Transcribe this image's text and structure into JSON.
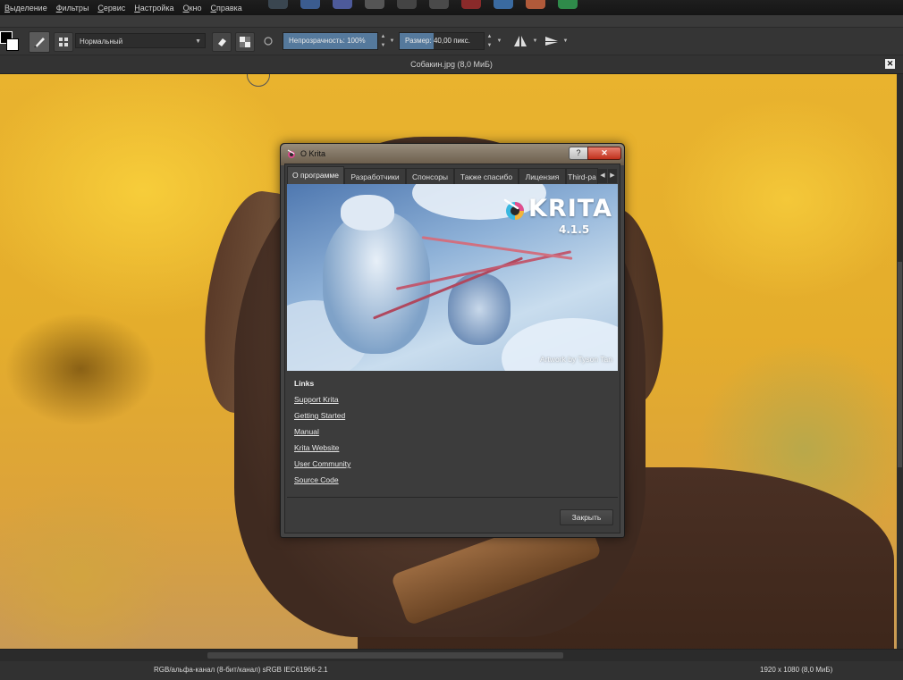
{
  "menubar": {
    "items": [
      "Выделение",
      "Фильтры",
      "Сервис",
      "Настройка",
      "Окно",
      "Справка"
    ]
  },
  "toolbar": {
    "blend_mode": "Нормальный",
    "opacity_label": "Непрозрачность:",
    "opacity_value": "100%",
    "opacity_fraction": 1.0,
    "size_label": "Размер:",
    "size_value": "40,00 пикс."
  },
  "document": {
    "title": "Собакин.jpg (8,0 МиБ)"
  },
  "status": {
    "color_profile": "RGB/альфа-канал (8-бит/канал)  sRGB IEC61966-2.1",
    "dimensions": "1920 x 1080 (8,0 МиБ)"
  },
  "dialog": {
    "title": "О Krita",
    "help_label": "?",
    "close_label": "✕",
    "tabs": [
      "О программе",
      "Разработчики",
      "Спонсоры",
      "Также спасибо",
      "Лицензия",
      "Third-pa"
    ],
    "active_tab": 0,
    "banner": {
      "logo_text": "KRITA",
      "version": "4.1.5",
      "credit": "Artwork by Tyson Tan"
    },
    "links_heading": "Links",
    "links": [
      "Support Krita",
      "Getting Started",
      "Manual",
      "Krita Website",
      "User Community",
      "Source Code"
    ],
    "close_button": "Закрыть"
  },
  "colors": {
    "accent": "#55799c",
    "dialog_bg": "#3c3c3c",
    "close_red": "#c0301c"
  },
  "icons": [
    "krita-app-icon",
    "eraser-icon",
    "alpha-lock-icon",
    "reload-preset-icon",
    "mirror-horizontal-icon",
    "mirror-vertical-icon",
    "brush-preset-icon",
    "pattern-icon"
  ]
}
